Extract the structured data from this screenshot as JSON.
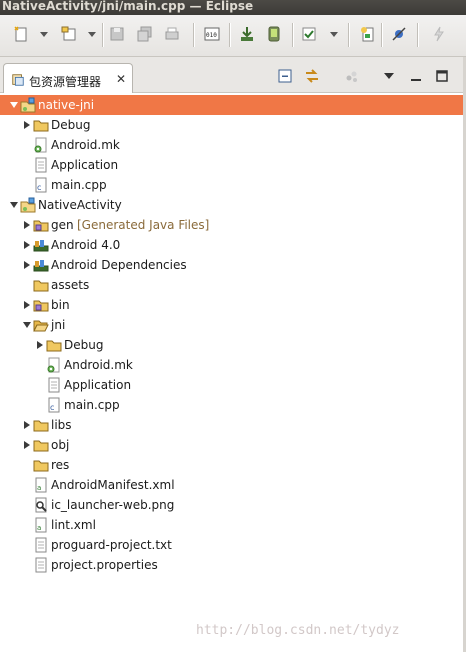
{
  "window": {
    "title": "NativeActivity/jni/main.cpp — Eclipse"
  },
  "toolbar": {
    "buttons": [
      {
        "icon": "new-icon"
      },
      {
        "icon": "new-drop-icon"
      },
      {
        "icon": "new-class-icon"
      },
      {
        "icon": "new-class-drop-icon"
      },
      {
        "icon": "save-icon"
      },
      {
        "icon": "save-all-icon"
      },
      {
        "icon": "print-icon"
      },
      {
        "icon": "binary-icon"
      },
      {
        "icon": "download-icon"
      },
      {
        "icon": "android-device-icon"
      },
      {
        "icon": "task-check-icon"
      },
      {
        "icon": "new-file-icon"
      },
      {
        "icon": "skip-breakpoints-icon"
      },
      {
        "icon": "lightning-icon"
      }
    ]
  },
  "view": {
    "tab_label": "包资源管理器",
    "close_glyph": "✕"
  },
  "tree": [
    {
      "label": "native-jni",
      "depth": 0,
      "expand": "down",
      "icon": "project-icon",
      "selected": true
    },
    {
      "label": "Debug",
      "depth": 1,
      "expand": "right",
      "icon": "folder-icon"
    },
    {
      "label": "Android.mk",
      "depth": 1,
      "icon": "mk-file-icon"
    },
    {
      "label": "Application",
      "depth": 1,
      "icon": "text-file-icon"
    },
    {
      "label": "main.cpp",
      "depth": 1,
      "icon": "cpp-file-icon"
    },
    {
      "label": "NativeActivity",
      "depth": 0,
      "expand": "down",
      "icon": "project-icon"
    },
    {
      "label": "gen",
      "decoration": "[Generated Java Files]",
      "depth": 1,
      "expand": "right",
      "icon": "source-folder-icon"
    },
    {
      "label": "Android 4.0",
      "depth": 1,
      "expand": "right",
      "icon": "library-icon"
    },
    {
      "label": "Android Dependencies",
      "depth": 1,
      "expand": "right",
      "icon": "library-icon"
    },
    {
      "label": "assets",
      "depth": 1,
      "icon": "folder-icon"
    },
    {
      "label": "bin",
      "depth": 1,
      "expand": "right",
      "icon": "source-folder-icon"
    },
    {
      "label": "jni",
      "depth": 1,
      "expand": "down",
      "icon": "folder-open-icon"
    },
    {
      "label": "Debug",
      "depth": 2,
      "expand": "right",
      "icon": "folder-icon"
    },
    {
      "label": "Android.mk",
      "depth": 2,
      "icon": "mk-file-icon"
    },
    {
      "label": "Application",
      "depth": 2,
      "icon": "text-file-icon"
    },
    {
      "label": "main.cpp",
      "depth": 2,
      "icon": "cpp-file-icon"
    },
    {
      "label": "libs",
      "depth": 1,
      "expand": "right",
      "icon": "folder-icon"
    },
    {
      "label": "obj",
      "depth": 1,
      "expand": "right",
      "icon": "folder-icon"
    },
    {
      "label": "res",
      "depth": 1,
      "icon": "folder-icon"
    },
    {
      "label": "AndroidManifest.xml",
      "depth": 1,
      "icon": "xml-file-icon"
    },
    {
      "label": "ic_launcher-web.png",
      "depth": 1,
      "icon": "image-file-icon"
    },
    {
      "label": "lint.xml",
      "depth": 1,
      "icon": "xml-file-icon"
    },
    {
      "label": "proguard-project.txt",
      "depth": 1,
      "icon": "text-file-icon"
    },
    {
      "label": "project.properties",
      "depth": 1,
      "icon": "text-file-icon"
    }
  ],
  "watermark": "http://blog.csdn.net/tydyz"
}
